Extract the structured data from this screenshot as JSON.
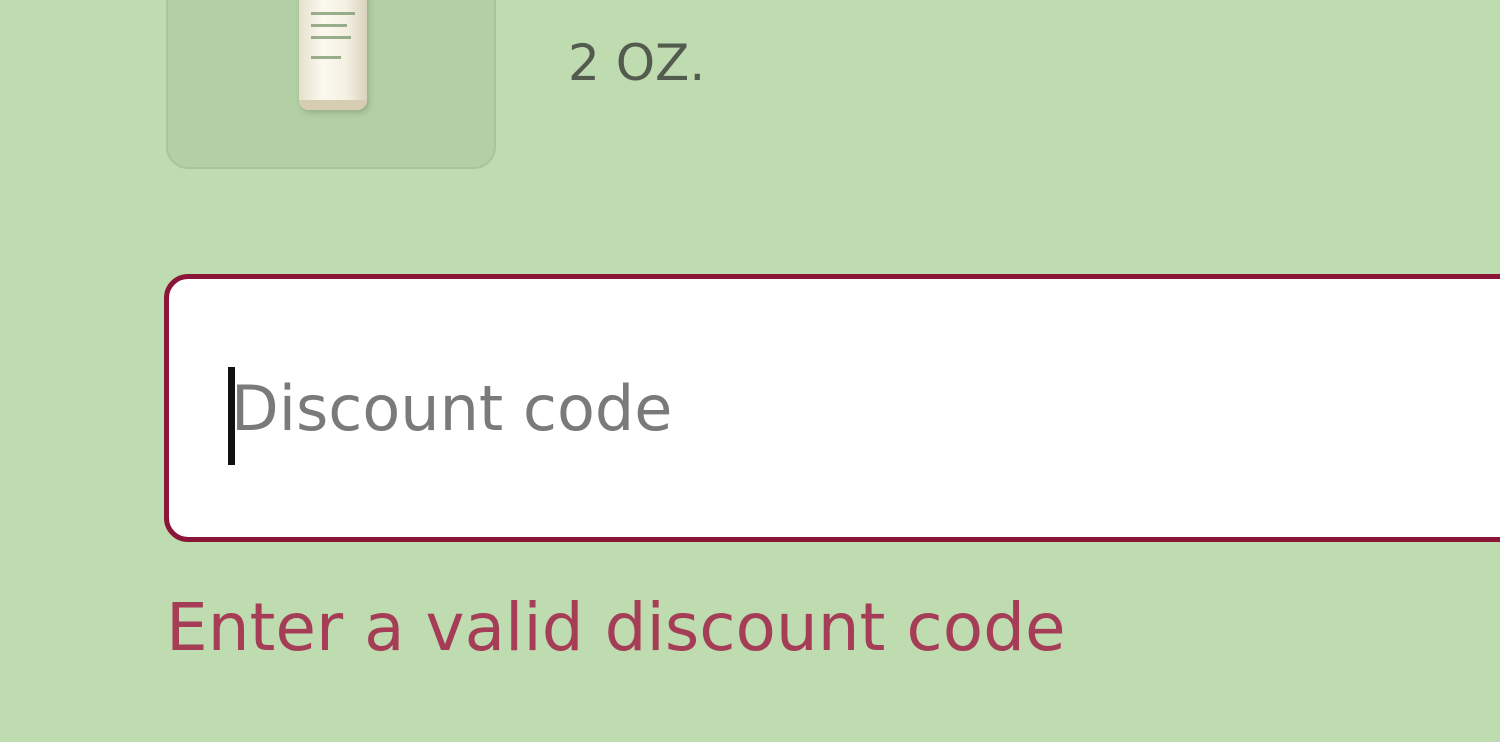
{
  "product": {
    "thumbnail_icon": "product-bottle-image",
    "variant": "2 OZ."
  },
  "discount": {
    "placeholder": "Discount code",
    "value": "",
    "error": "Enter a valid discount code"
  },
  "colors": {
    "background": "#bfdbb0",
    "error": "#8b1538",
    "error_text": "#a63d57"
  }
}
